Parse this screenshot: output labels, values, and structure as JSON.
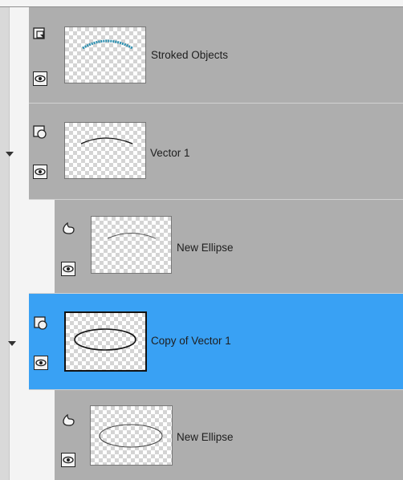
{
  "layers": [
    {
      "name": "Stroked Objects",
      "type_icon": "layer-group-icon",
      "visible": true,
      "expanded": null,
      "selected": false
    },
    {
      "name": "Vector 1",
      "type_icon": "vector-layer-icon",
      "visible": true,
      "expanded": true,
      "selected": false
    },
    {
      "name": "New Ellipse",
      "type_icon": "shape-icon",
      "visible": true,
      "expanded": null,
      "selected": false
    },
    {
      "name": "Copy of Vector 1",
      "type_icon": "vector-layer-icon",
      "visible": true,
      "expanded": true,
      "selected": true
    },
    {
      "name": "New Ellipse",
      "type_icon": "shape-icon",
      "visible": true,
      "expanded": null,
      "selected": false
    }
  ],
  "colors": {
    "row_bg": "#aeaeae",
    "selected_bg": "#39a1f4",
    "stroke_accent": "#2b8fb0"
  }
}
